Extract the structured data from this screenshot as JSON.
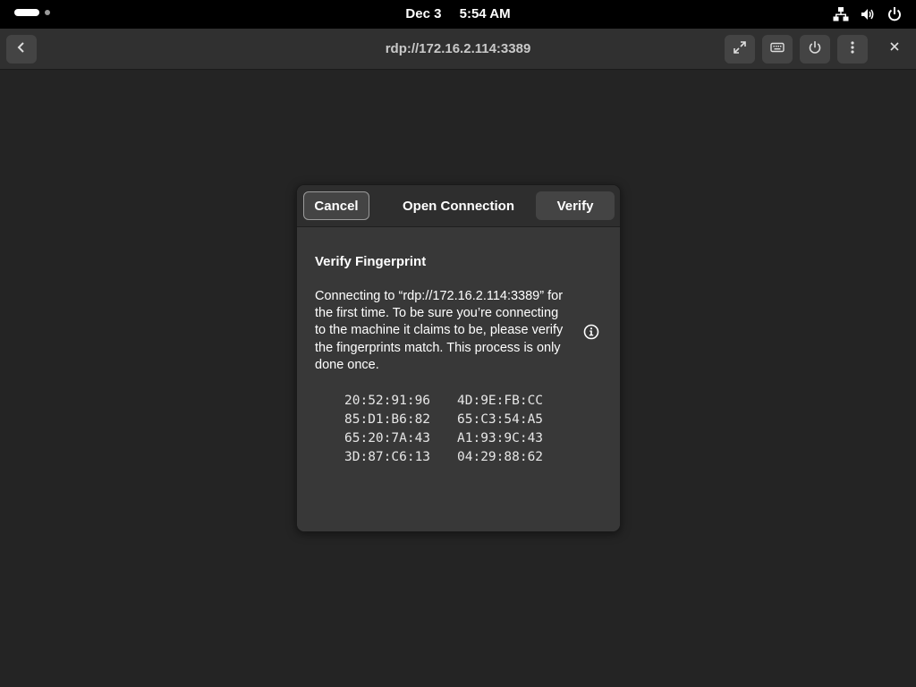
{
  "topbar": {
    "date": "Dec 3",
    "time": "5:54 AM"
  },
  "header": {
    "title": "rdp://172.16.2.114:3389",
    "icons": [
      "back-icon",
      "fullscreen-icon",
      "keyboard-icon",
      "power-icon",
      "menu-icon",
      "close-icon"
    ]
  },
  "dialog": {
    "cancel_label": "Cancel",
    "title": "Open Connection",
    "verify_label": "Verify",
    "heading": "Verify Fingerprint",
    "message": "Connecting to “rdp://172.16.2.114:3389” for the first time. To be sure you’re connecting to the machine it claims to be, please verify the fingerprints match. This process is only done once.",
    "fingerprints": [
      "20:52:91:96",
      "4D:9E:FB:CC",
      "85:D1:B6:82",
      "65:C3:54:A5",
      "65:20:7A:43",
      "A1:93:9C:43",
      "3D:87:C6:13",
      "04:29:88:62"
    ]
  },
  "colors": {
    "background": "#242424",
    "headerbar": "#303030",
    "dialog": "#383838",
    "button": "#444444"
  }
}
